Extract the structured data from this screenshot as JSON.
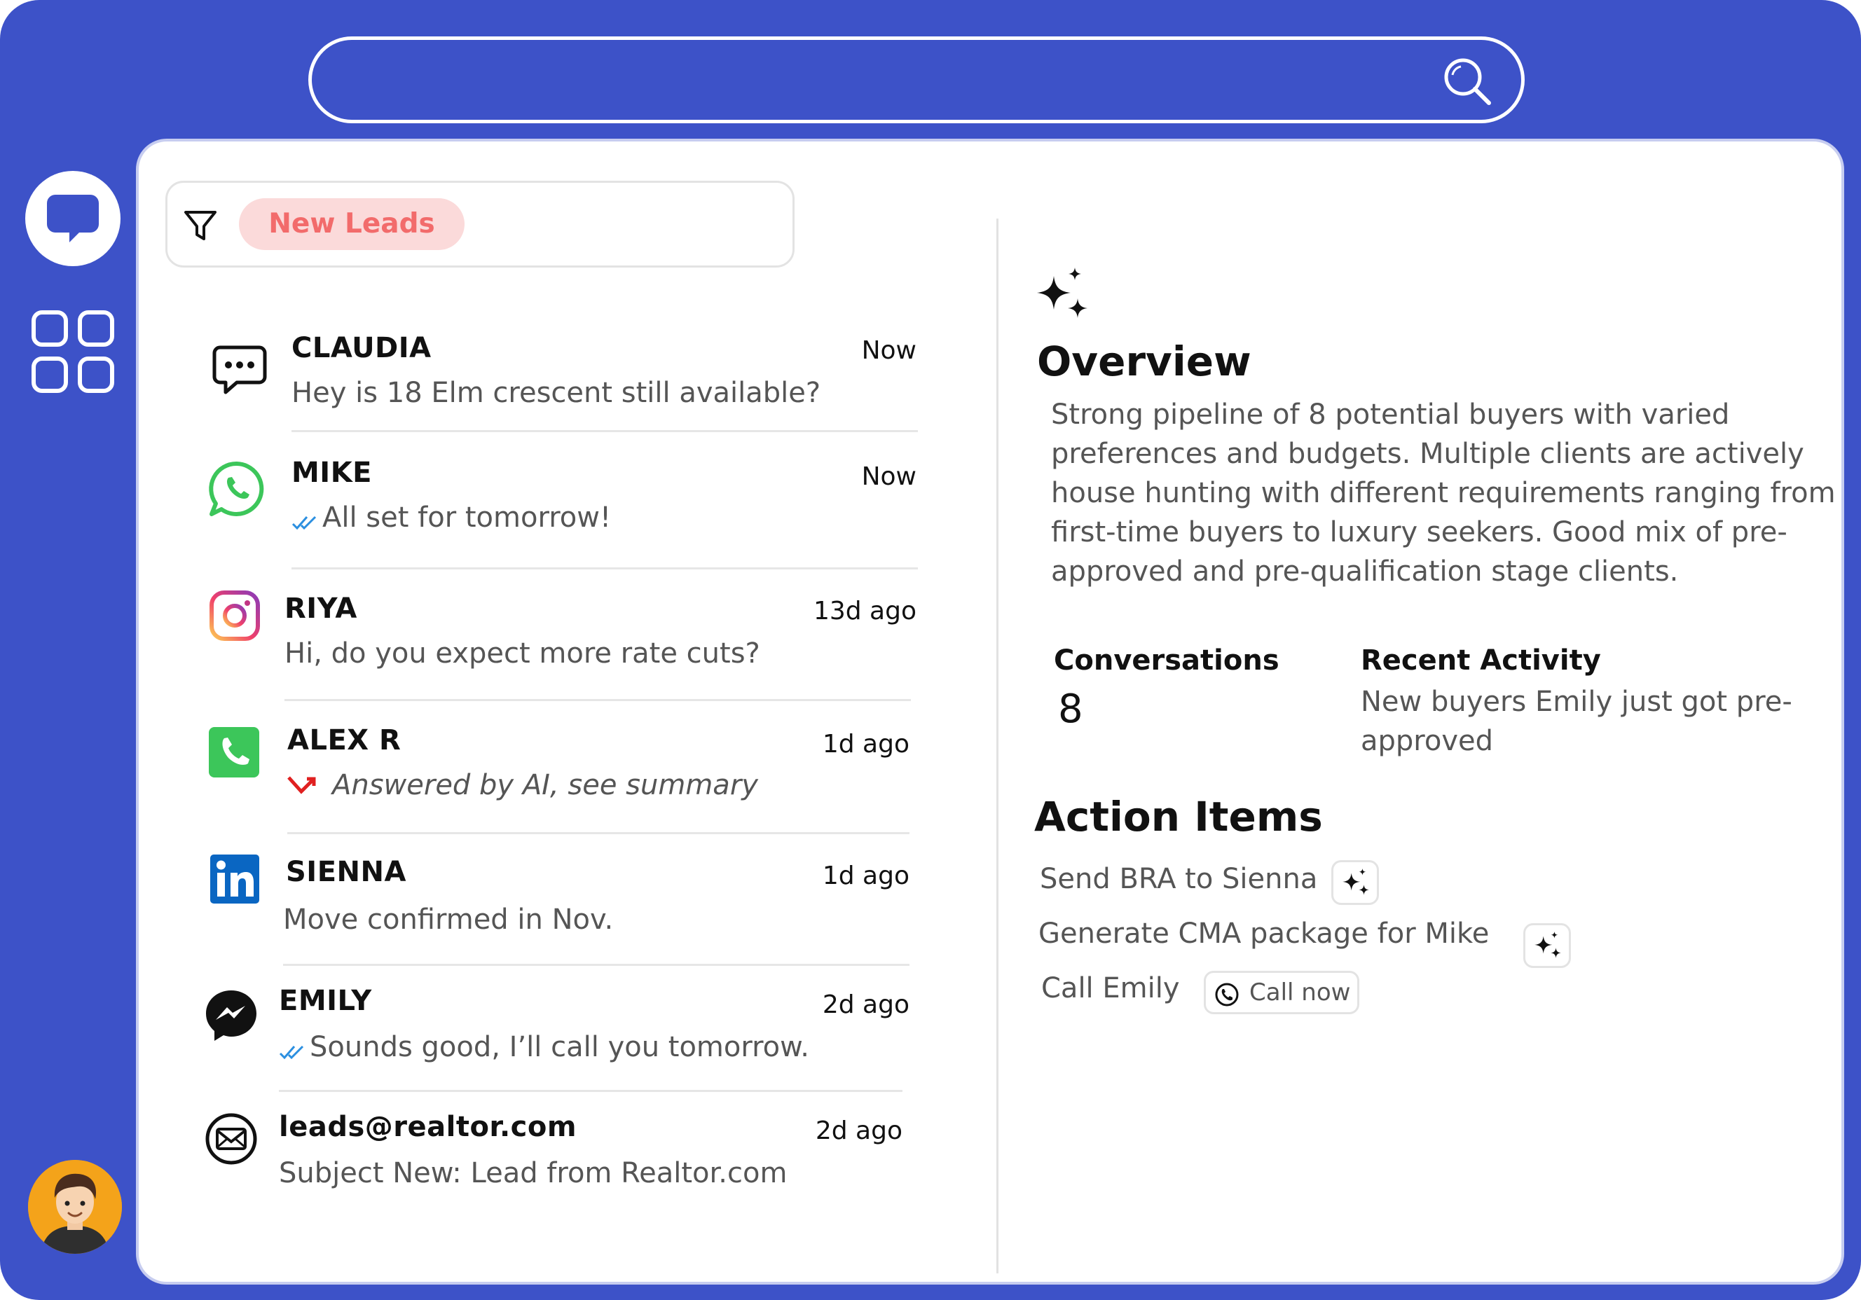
{
  "search": {
    "placeholder": ""
  },
  "filter": {
    "chip_label": "New Leads"
  },
  "leads": [
    {
      "name": "CLAUDIA",
      "time": "Now",
      "message": "Hey is 18 Elm crescent still available?",
      "channel_icon": "sms-chat-icon"
    },
    {
      "name": "MIKE",
      "time": "Now",
      "message": "All set for tomorrow!",
      "channel_icon": "whatsapp-icon",
      "status_icon": "double-check-icon"
    },
    {
      "name": "RIYA",
      "time": "13d ago",
      "message": "Hi, do you expect more rate cuts?",
      "channel_icon": "instagram-icon"
    },
    {
      "name": "ALEX R",
      "time": "1d ago",
      "message": "Answered by AI, see summary",
      "channel_icon": "phone-icon",
      "status_icon": "missed-call-icon"
    },
    {
      "name": "SIENNA",
      "time": "1d ago",
      "message": "Move confirmed in Nov.",
      "channel_icon": "linkedin-icon"
    },
    {
      "name": "EMILY",
      "time": "2d ago",
      "message": "Sounds good, I’ll call you tomorrow.",
      "channel_icon": "messenger-icon",
      "status_icon": "double-check-icon"
    },
    {
      "name": "leads@realtor.com",
      "time": "2d ago",
      "message": "Subject New: Lead from Realtor.com",
      "channel_icon": "email-icon"
    }
  ],
  "overview": {
    "title": "Overview",
    "text": "Strong pipeline of 8 potential buyers with varied preferences and budgets. Multiple clients are actively house hunting with different requirements ranging from first-time buyers to luxury seekers. Good mix of pre-approved and pre-qualification stage clients."
  },
  "stats": {
    "conversations_label": "Conversations",
    "conversations_value": "8",
    "recent_label": "Recent Activity",
    "recent_text": "New buyers Emily just got pre-approved"
  },
  "actions": {
    "title": "Action Items",
    "items": [
      {
        "label": "Send BRA to Sienna"
      },
      {
        "label": "Generate CMA package for Mike"
      },
      {
        "label": "Call Emily",
        "button": "Call now"
      }
    ]
  },
  "colors": {
    "frame": "#3d52c8",
    "chip_bg": "#fbdada",
    "chip_text": "#f26b6b",
    "check_blue": "#2b8fe0",
    "missed_red": "#e02020"
  }
}
